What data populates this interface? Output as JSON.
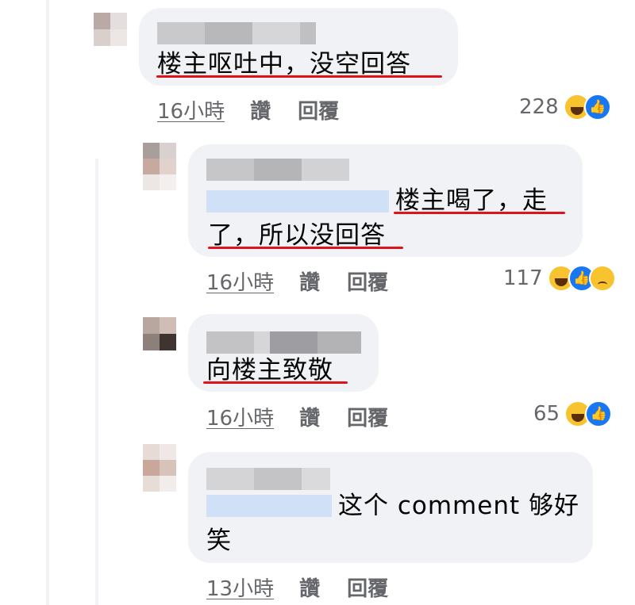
{
  "comments": [
    {
      "text": "楼主呕吐中，没空回答",
      "time": "16小時",
      "like_label": "讚",
      "reply_label": "回覆",
      "reaction_count": "228",
      "reactions": [
        "haha-icon",
        "like-icon"
      ]
    },
    {
      "text_line1": "楼主喝了，走",
      "text_line2": "了，所以没回答",
      "time": "16小時",
      "like_label": "讚",
      "reply_label": "回覆",
      "reaction_count": "117",
      "reactions": [
        "haha-icon",
        "like-icon",
        "sad-icon"
      ]
    },
    {
      "text": "向楼主致敬",
      "time": "16小時",
      "like_label": "讚",
      "reply_label": "回覆",
      "reaction_count": "65",
      "reactions": [
        "haha-icon",
        "like-icon"
      ]
    },
    {
      "text_line1": "这个 comment 够好",
      "text_line2": "笑",
      "time": "13小時",
      "like_label": "讚",
      "reply_label": "回覆"
    }
  ],
  "colors": {
    "bubble": "#f0f2f5",
    "meta_text": "#65676b",
    "underline_annotation": "#e0121a",
    "like_blue": "#1877f2",
    "haha_yellow": "#f7c32e"
  }
}
